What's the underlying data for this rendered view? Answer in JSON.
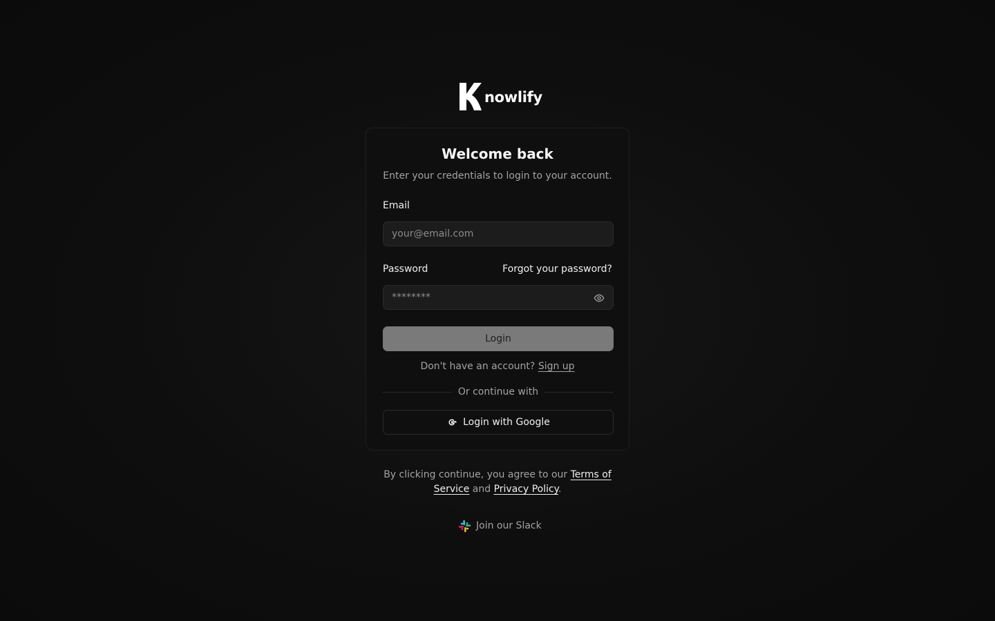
{
  "brand": {
    "logo_letter": "K",
    "name": "nowlify"
  },
  "card": {
    "title": "Welcome back",
    "subtitle": "Enter your credentials to login to your account."
  },
  "email": {
    "label": "Email",
    "placeholder": "your@email.com",
    "value": ""
  },
  "password": {
    "label": "Password",
    "placeholder": "********",
    "value": "",
    "forgot_label": "Forgot your password?"
  },
  "login_button": "Login",
  "signup": {
    "prompt": "Don't have an account?",
    "link": "Sign up"
  },
  "divider": "Or continue with",
  "google_button": "Login with Google",
  "terms": {
    "prefix": "By clicking continue, you agree to our",
    "terms_link": "Terms of Service",
    "joiner": "and",
    "privacy_link": "Privacy Policy",
    "suffix": "."
  },
  "slack": {
    "label": "Join our Slack",
    "icon": "slack-icon"
  },
  "colors": {
    "background": "#0e0e0e",
    "card": "#0f0f0f",
    "button_disabled": "#7a7a7a",
    "muted_text": "#a3a3a3"
  }
}
